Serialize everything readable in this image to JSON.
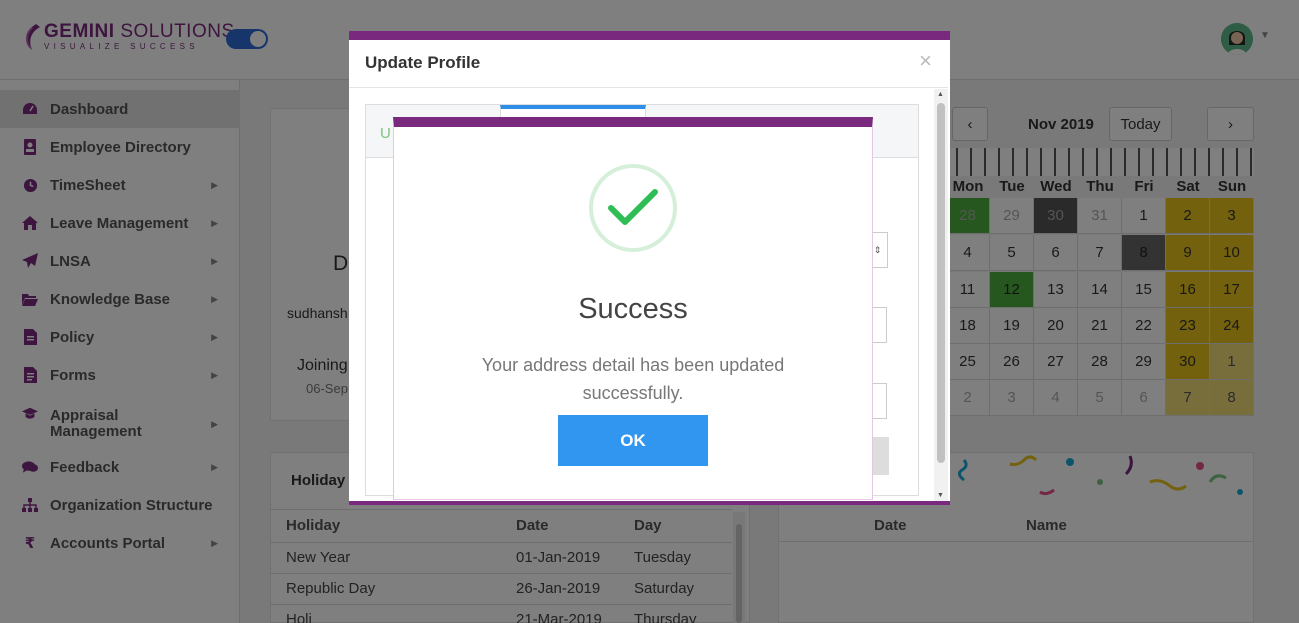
{
  "header": {
    "brand_name_bold": "GEMINI",
    "brand_name_rest": " SOLUTIONS",
    "brand_tagline": "VISUALIZE SUCCESS"
  },
  "sidebar": {
    "items": [
      {
        "label": "Dashboard",
        "icon": "dashboard-icon",
        "active": true
      },
      {
        "label": "Employee Directory",
        "icon": "address-book-icon"
      },
      {
        "label": "TimeSheet",
        "icon": "clock-icon"
      },
      {
        "label": "Leave Management",
        "icon": "home-icon"
      },
      {
        "label": "LNSA",
        "icon": "paper-plane-icon"
      },
      {
        "label": "Knowledge Base",
        "icon": "folder-open-icon"
      },
      {
        "label": "Policy",
        "icon": "file-icon"
      },
      {
        "label": "Forms",
        "icon": "file-text-icon"
      },
      {
        "label": "Appraisal Management",
        "icon": "graduation-cap-icon"
      },
      {
        "label": "Feedback",
        "icon": "comments-icon"
      },
      {
        "label": "Organization Structure",
        "icon": "sitemap-icon"
      },
      {
        "label": "Accounts Portal",
        "icon": "rupee-icon"
      }
    ]
  },
  "profile_card": {
    "initial_fragment": "D",
    "name_fragment": "sudhansh",
    "joining_label_fragment": "Joining",
    "joining_date_fragment": "06-Sep"
  },
  "holidays": {
    "title_fragment": "Holiday",
    "columns": [
      "Holiday",
      "Date",
      "Day"
    ],
    "rows": [
      [
        "New Year",
        "01-Jan-2019",
        "Tuesday"
      ],
      [
        "Republic Day",
        "26-Jan-2019",
        "Saturday"
      ],
      [
        "Holi",
        "21-Mar-2019",
        "Thursday"
      ]
    ]
  },
  "birthdays": {
    "columns": [
      "Date",
      "Name"
    ]
  },
  "calendar": {
    "month_label": "Nov 2019",
    "today_label": "Today",
    "prev_label": "‹",
    "next_label": "›",
    "weekdays": [
      "Mon",
      "Tue",
      "Wed",
      "Thu",
      "Fri",
      "Sat",
      "Sun"
    ],
    "weeks": [
      [
        "28",
        "29",
        "30",
        "31",
        "1",
        "2",
        "3"
      ],
      [
        "4",
        "5",
        "6",
        "7",
        "8",
        "9",
        "10"
      ],
      [
        "11",
        "12",
        "13",
        "14",
        "15",
        "16",
        "17"
      ],
      [
        "18",
        "19",
        "20",
        "21",
        "22",
        "23",
        "24"
      ],
      [
        "25",
        "26",
        "27",
        "28",
        "29",
        "30",
        "1"
      ],
      [
        "2",
        "3",
        "4",
        "5",
        "6",
        "7",
        "8"
      ]
    ],
    "colors": {
      "holiday_green": "#4caf3c",
      "weekend_yellow": "#e6c21a",
      "dark_gray": "#555555"
    }
  },
  "update_profile_modal": {
    "title": "Update Profile",
    "close_label": "×",
    "tab_green_fragment": "U"
  },
  "success_dialog": {
    "title": "Success",
    "message": "Your address detail has been updated successfully.",
    "ok_label": "OK",
    "colors": {
      "header_bar": "#7a2a7e",
      "ok_button": "#3096f0",
      "check": "#2fbe56"
    }
  }
}
